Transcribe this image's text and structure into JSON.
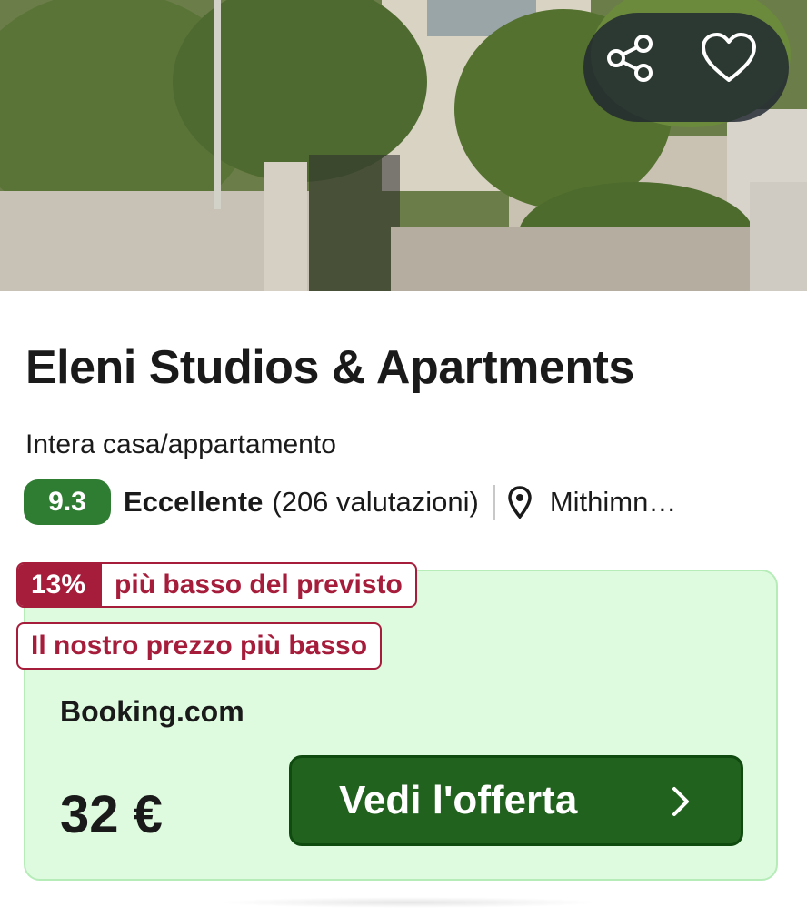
{
  "photo": {
    "alt_icon": "property-photo"
  },
  "actions": {
    "share_icon": "share-icon",
    "favorite_icon": "heart-icon"
  },
  "property": {
    "name": "Eleni Studios & Apartments",
    "type": "Intera casa/appartamento",
    "score": "9.3",
    "rating_word": "Eccellente",
    "rating_count": "(206 valutazioni)",
    "location": "Mithimn…"
  },
  "offer": {
    "deal_percent": "13%",
    "deal_text": "più basso del previsto",
    "lowest_price_text": "Il nostro prezzo più basso",
    "provider": "Booking.com",
    "price": "32 €",
    "cta_label": "Vedi l'offerta"
  },
  "colors": {
    "score_badge": "#2f7d32",
    "deal_red": "#a61d3b",
    "offer_bg": "#defbdf",
    "cta_bg": "#22621f"
  }
}
